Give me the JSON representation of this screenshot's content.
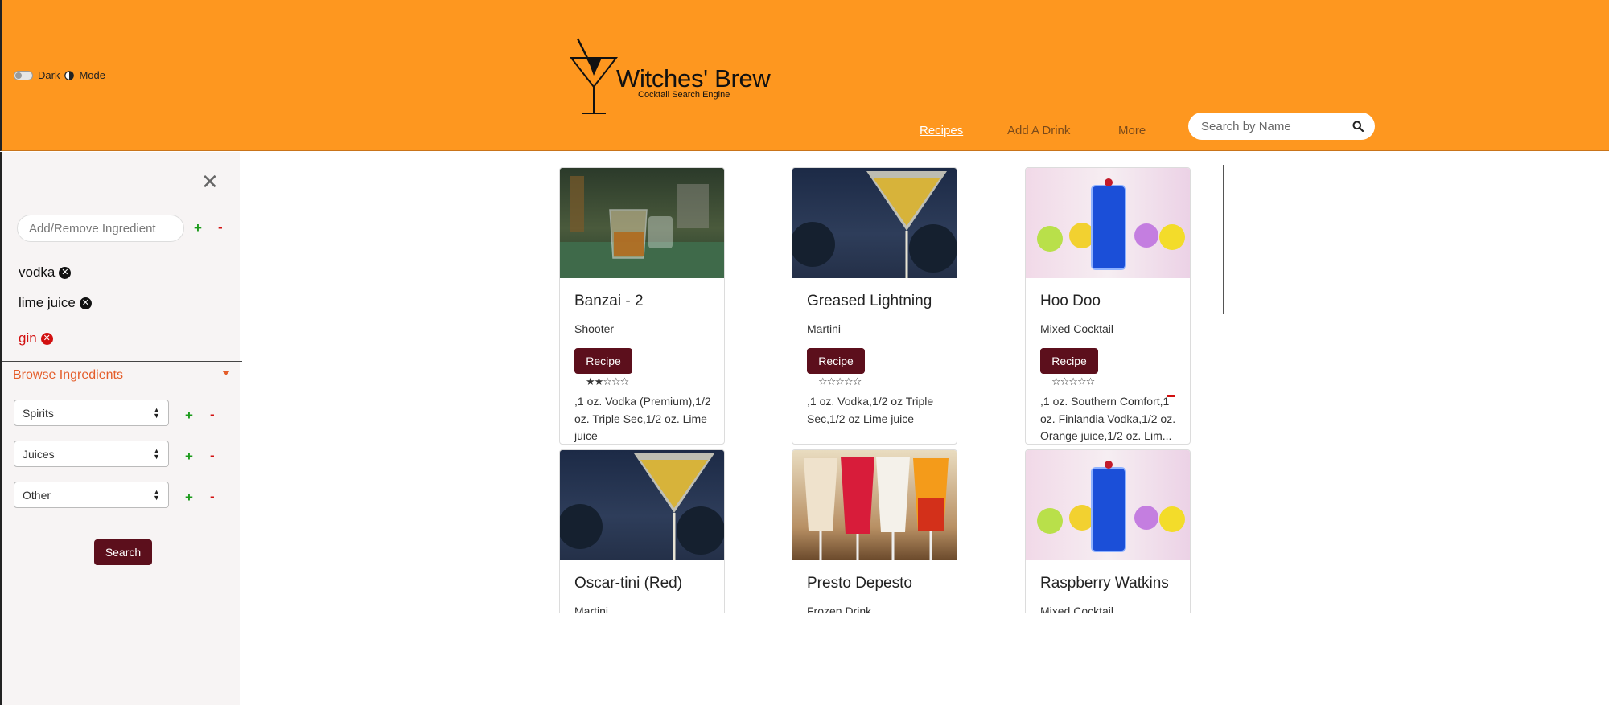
{
  "header": {
    "dark_mode": {
      "label_dark": "Dark",
      "label_mode": "Mode",
      "enabled": false
    },
    "logo": {
      "title": "Witches' Brew",
      "subtitle": "Cocktail Search Engine"
    },
    "nav": [
      {
        "label": "Recipes",
        "active": true
      },
      {
        "label": "Add A Drink",
        "active": false
      },
      {
        "label": "More",
        "active": false
      }
    ],
    "search": {
      "placeholder": "Search by Name",
      "icon": "search-icon"
    }
  },
  "sidebar": {
    "ingredient_input": {
      "placeholder": "Add/Remove Ingredient",
      "value": ""
    },
    "add_symbol": "+",
    "remove_symbol": "-",
    "selected_ingredients": [
      {
        "name": "vodka",
        "excluded": false
      },
      {
        "name": "lime juice",
        "excluded": false
      },
      {
        "name": "gin",
        "excluded": true
      }
    ],
    "browse_title": "Browse Ingredients",
    "browse_selects": [
      {
        "selected": "Spirits"
      },
      {
        "selected": "Juices"
      },
      {
        "selected": "Other"
      }
    ],
    "search_button": "Search"
  },
  "cards": [
    {
      "title": "Banzai - 2",
      "category": "Shooter",
      "button": "Recipe",
      "rating": 2,
      "max_rating": 5,
      "ingredients": ",1 oz. Vodka (Premium),1/2 oz. Triple Sec,1/2 oz. Lime juice",
      "image": "whiskey-glass-bar"
    },
    {
      "title": "Greased Lightning",
      "category": "Martini",
      "button": "Recipe",
      "rating": 0,
      "max_rating": 5,
      "ingredients": ",1 oz. Vodka,1/2 oz Triple Sec,1/2 oz Lime juice",
      "image": "yellow-martini"
    },
    {
      "title": "Hoo Doo",
      "category": "Mixed Cocktail",
      "button": "Recipe",
      "rating": 0,
      "max_rating": 5,
      "ingredients": ",1 oz. Southern Comfort,1 oz. Finlandia Vodka,1/2 oz. Orange juice,1/2 oz. Lim...",
      "image": "blue-highball"
    },
    {
      "title": "Oscar-tini (Red)",
      "category": "Martini",
      "image": "yellow-martini"
    },
    {
      "title": "Presto Depesto",
      "category": "Frozen Drink",
      "image": "frozen-drinks"
    },
    {
      "title": "Raspberry Watkins",
      "category": "Mixed Cocktail",
      "image": "blue-highball"
    }
  ],
  "colors": {
    "header_bg": "#fe971f",
    "button_bg": "#5c0f1c",
    "add_green": "#1a9a1a",
    "remove_red": "#d21010",
    "browse_accent": "#e45d2a"
  }
}
